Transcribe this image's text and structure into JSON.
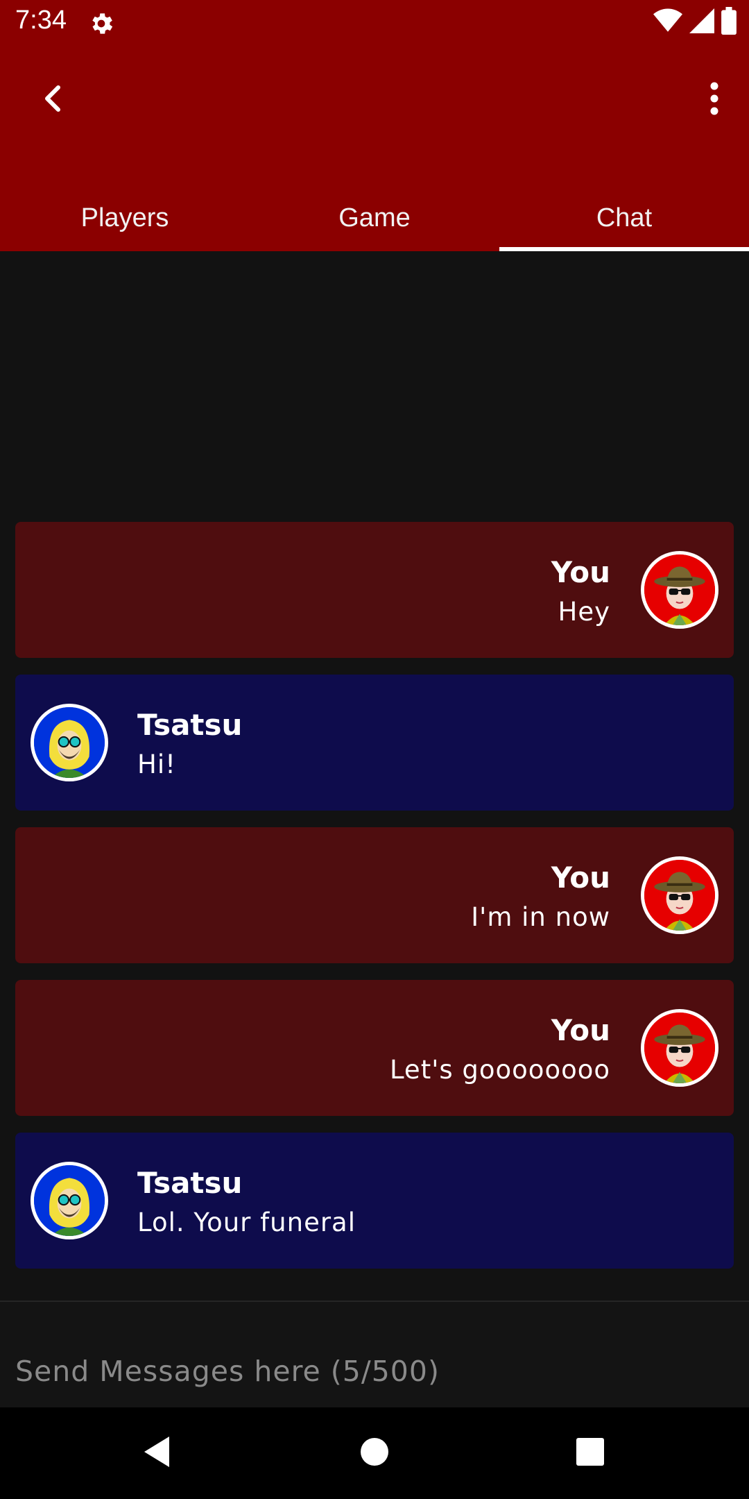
{
  "status_bar": {
    "time": "7:34",
    "icons": [
      "settings-icon",
      "wifi-icon",
      "signal-icon",
      "battery-icon"
    ]
  },
  "app_bar": {
    "back_icon": "chevron-left-icon",
    "menu_icon": "more-vertical-icon",
    "tabs": [
      {
        "label": "Players",
        "active": false
      },
      {
        "label": "Game",
        "active": false
      },
      {
        "label": "Chat",
        "active": true
      }
    ]
  },
  "chat": {
    "messages": [
      {
        "sender": "You",
        "text": "Hey",
        "self": true
      },
      {
        "sender": "Tsatsu",
        "text": "Hi!",
        "self": false
      },
      {
        "sender": "You",
        "text": "I'm in now",
        "self": true
      },
      {
        "sender": "You",
        "text": "Let's goooooooo",
        "self": true
      },
      {
        "sender": "Tsatsu",
        "text": "Lol. Your funeral",
        "self": false
      }
    ]
  },
  "composer": {
    "placeholder": "Send Messages here (5/500)",
    "value": ""
  },
  "colors": {
    "primary": "#8b0000",
    "self_bubble": "#4f0d0f",
    "other_bubble": "#0e0c4c",
    "background": "#121212"
  },
  "nav_bar": {
    "icons": [
      "back-triangle-icon",
      "home-circle-icon",
      "recents-square-icon"
    ]
  }
}
